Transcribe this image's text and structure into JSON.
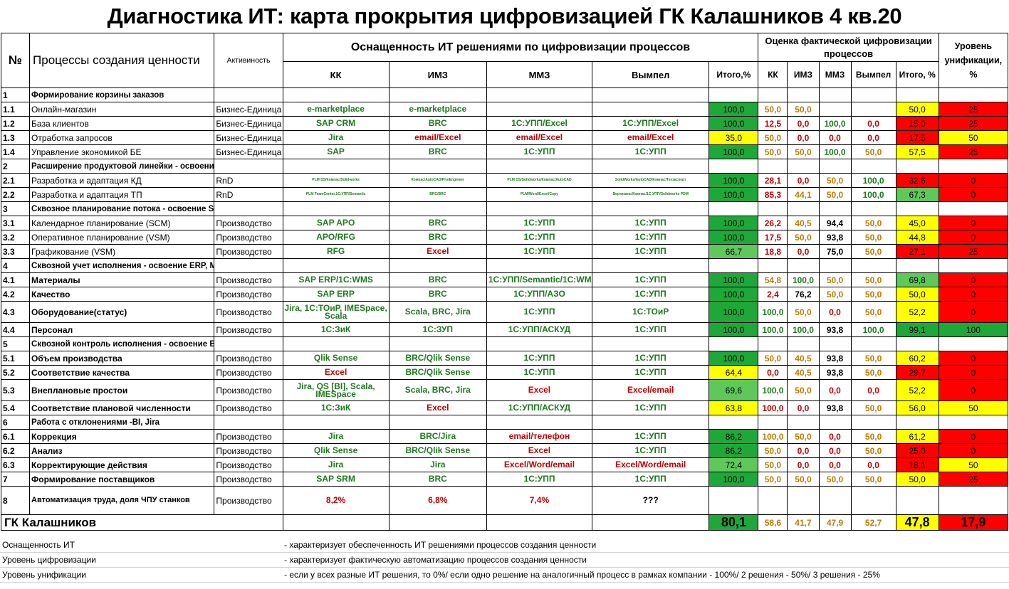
{
  "title": "Диагностика ИТ: карта прокрытия цифровизацией ГК Калашников 4 кв.20",
  "header": {
    "num": "№",
    "process": "Процессы создания ценности",
    "activity": "Активиность",
    "equipment_group": "Оснащенность ИТ решениями по цифровизации процессов",
    "digital_group": "Оценка фактической цифровизации процессов",
    "unification": "Уровень унификации, %",
    "cols": [
      "КК",
      "ИМЗ",
      "ММЗ",
      "Вымпел",
      "Итого,%"
    ],
    "dcols": [
      "КК",
      "ИМЗ",
      "ММЗ",
      "Вымпел",
      "Итого, %"
    ]
  },
  "rows": [
    {
      "t": "s",
      "num": "1",
      "name": "Формирование корзины заказов"
    },
    {
      "t": "r",
      "num": "1.1",
      "name": "Онлайн-магазин",
      "bold": false,
      "act": "Бизнес-Единица",
      "sys": [
        [
          "e-marketplace",
          "g"
        ],
        [
          "e-marketplace",
          "g"
        ],
        [
          "",
          ""
        ],
        [
          "",
          ""
        ]
      ],
      "tot": "100,0",
      "tc": "g",
      "v": [
        [
          "50,0",
          "o"
        ],
        [
          "50,0",
          "o"
        ],
        [
          "",
          ""
        ],
        [
          "",
          ""
        ]
      ],
      "dt": "50,0",
      "dc": "y",
      "u": "25",
      "uc": "r"
    },
    {
      "t": "r",
      "num": "1.2",
      "name": "База клиентов",
      "bold": false,
      "act": "Бизнес-Единица",
      "sys": [
        [
          "SAP CRM",
          "g"
        ],
        [
          "BRC",
          "g"
        ],
        [
          "1C:УПП/Excel",
          "g"
        ],
        [
          "1C:УПП/Excel",
          "g"
        ]
      ],
      "tot": "100,0",
      "tc": "g",
      "v": [
        [
          "12,5",
          "r"
        ],
        [
          "0,0",
          "r"
        ],
        [
          "100,0",
          "gr"
        ],
        [
          "0,0",
          "r"
        ]
      ],
      "dt": "15,0",
      "dc": "r",
      "u": "25",
      "uc": "r"
    },
    {
      "t": "r",
      "num": "1.3",
      "name": "Отработка запросов",
      "bold": false,
      "act": "Бизнес-Единица",
      "sys": [
        [
          "Jira",
          "g"
        ],
        [
          "email/Excel",
          "r"
        ],
        [
          "email/Excel",
          "r"
        ],
        [
          "email/Excel",
          "r"
        ]
      ],
      "tot": "35,0",
      "tc": "y",
      "v": [
        [
          "50,0",
          "o"
        ],
        [
          "0,0",
          "r"
        ],
        [
          "0,0",
          "r"
        ],
        [
          "0,0",
          "r"
        ]
      ],
      "dt": "17,5",
      "dc": "r",
      "u": "50",
      "uc": "y"
    },
    {
      "t": "r",
      "num": "1.4",
      "name": "Управление экономикой БЕ",
      "bold": false,
      "act": "Бизнес-Единица",
      "sys": [
        [
          "SAP",
          "g"
        ],
        [
          "BRC",
          "g"
        ],
        [
          "1C:УПП",
          "g"
        ],
        [
          "1C:УПП",
          "g"
        ]
      ],
      "tot": "100,0",
      "tc": "g",
      "v": [
        [
          "50,0",
          "o"
        ],
        [
          "50,0",
          "o"
        ],
        [
          "100,0",
          "gr"
        ],
        [
          "50,0",
          "o"
        ]
      ],
      "dt": "57,5",
      "dc": "y",
      "u": "25",
      "uc": "r"
    },
    {
      "t": "s",
      "num": "2",
      "name": "Расширение продуктовой линейки - освоение PLM"
    },
    {
      "t": "r",
      "num": "2.1",
      "name": "Разработка и адаптация КД",
      "bold": false,
      "act": "RnD",
      "sys": [
        [
          "PLM DS/Компас/Solidworks",
          "g",
          "small"
        ],
        [
          "Компас/AutoCAD/Pro/Engineer",
          "g",
          "small"
        ],
        [
          "PLM DS/Solidworks/Компас/AutoCAD",
          "g",
          "small"
        ],
        [
          "SolidWorks/AutoCAD/Компас/Техэксперт",
          "g",
          "small"
        ]
      ],
      "tot": "100,0",
      "tc": "g",
      "v": [
        [
          "28,1",
          "r"
        ],
        [
          "0,0",
          "r"
        ],
        [
          "50,0",
          "o"
        ],
        [
          "100,0",
          "gr"
        ]
      ],
      "dt": "32,6",
      "dc": "r",
      "u": "0",
      "uc": "r"
    },
    {
      "t": "r",
      "num": "2.2",
      "name": "Разработка и адаптация ТП",
      "bold": false,
      "act": "RnD",
      "sys": [
        [
          "PLM TeamCenter,1C:УПП/Semantic",
          "g",
          "small"
        ],
        [
          "BRC/BRC",
          "g",
          "small"
        ],
        [
          "PLM/Word/Excel/Copy",
          "g",
          "small"
        ],
        [
          "Вертикаль/Компас/1C:УПП/Solidworks PDM",
          "g",
          "small"
        ]
      ],
      "tot": "100,0",
      "tc": "g",
      "v": [
        [
          "85,3",
          "r"
        ],
        [
          "44,1",
          "o"
        ],
        [
          "50,0",
          "o"
        ],
        [
          "100,0",
          "gr"
        ]
      ],
      "dt": "67,3",
      "dc": "lg",
      "u": "0",
      "uc": "r"
    },
    {
      "t": "s",
      "num": "3",
      "name": "Сквозное планирование потока - освоение SCM/APS"
    },
    {
      "t": "r",
      "num": "3.1",
      "name": "Календарное планирование (SCM)",
      "bold": false,
      "act": "Производство",
      "sys": [
        [
          "SAP APO",
          "g"
        ],
        [
          "BRC",
          "g"
        ],
        [
          "1C:УПП",
          "g"
        ],
        [
          "1C:УПП",
          "g"
        ]
      ],
      "tot": "100,0",
      "tc": "g",
      "v": [
        [
          "26,2",
          "r"
        ],
        [
          "40,5",
          "o"
        ],
        [
          "94,4",
          "k"
        ],
        [
          "50,0",
          "o"
        ]
      ],
      "dt": "45,0",
      "dc": "y",
      "u": "0",
      "uc": "r"
    },
    {
      "t": "r",
      "num": "3.2",
      "name": "Оперативное планирование (VSM)",
      "bold": false,
      "act": "Производство",
      "sys": [
        [
          "APO/RFG",
          "g"
        ],
        [
          "BRC",
          "g"
        ],
        [
          "1C:УПП",
          "g"
        ],
        [
          "1C:УПП",
          "g"
        ]
      ],
      "tot": "100,0",
      "tc": "g",
      "v": [
        [
          "17,5",
          "r"
        ],
        [
          "50,0",
          "o"
        ],
        [
          "93,8",
          "k"
        ],
        [
          "50,0",
          "o"
        ]
      ],
      "dt": "44,8",
      "dc": "y",
      "u": "0",
      "uc": "r"
    },
    {
      "t": "r",
      "num": "3.3",
      "name": "Графикование (VSM)",
      "bold": false,
      "act": "Производство",
      "sys": [
        [
          "RFG",
          "g"
        ],
        [
          "Excel",
          "r"
        ],
        [
          "1C:УПП",
          "g"
        ],
        [
          "1C:УПП",
          "g"
        ]
      ],
      "tot": "66,7",
      "tc": "lg",
      "v": [
        [
          "18,8",
          "r"
        ],
        [
          "0,0",
          "r"
        ],
        [
          "75,0",
          "k"
        ],
        [
          "50,0",
          "o"
        ]
      ],
      "dt": "27,1",
      "dc": "r",
      "u": "25",
      "uc": "r"
    },
    {
      "t": "s",
      "num": "4",
      "name": "Сквозной учет исполнения  - освоение ERP, MES, SCADA"
    },
    {
      "t": "r",
      "num": "4.1",
      "name": "Материалы",
      "bold": true,
      "act": "Производство",
      "sys": [
        [
          "SAP ERP/1C:WMS",
          "g"
        ],
        [
          "BRC",
          "g"
        ],
        [
          "1C:УПП/Semantic/1C:WMS",
          "g"
        ],
        [
          "1C:УПП",
          "g"
        ]
      ],
      "tot": "100,0",
      "tc": "g",
      "v": [
        [
          "54,8",
          "o"
        ],
        [
          "100,0",
          "gr"
        ],
        [
          "50,0",
          "o"
        ],
        [
          "50,0",
          "o"
        ]
      ],
      "dt": "69,8",
      "dc": "lg",
      "u": "0",
      "uc": "r"
    },
    {
      "t": "r",
      "num": "4.2",
      "name": "Качество",
      "bold": true,
      "act": "Производство",
      "sys": [
        [
          "SAP ERP",
          "g"
        ],
        [
          "BRC",
          "g"
        ],
        [
          "1C:УПП/АЗО",
          "g"
        ],
        [
          "1C:УПП",
          "g"
        ]
      ],
      "tot": "100,0",
      "tc": "g",
      "v": [
        [
          "2,4",
          "r"
        ],
        [
          "76,2",
          "k"
        ],
        [
          "50,0",
          "o"
        ],
        [
          "50,0",
          "o"
        ]
      ],
      "dt": "50,0",
      "dc": "y",
      "u": "0",
      "uc": "r"
    },
    {
      "t": "r",
      "num": "4.3",
      "name": "Оборудование(статус)",
      "bold": true,
      "tall": true,
      "act": "Производство",
      "sys": [
        [
          "Jira, 1C:ТОиР, IMESpace, Scala",
          "g"
        ],
        [
          "Scala, BRC, Jira",
          "g"
        ],
        [
          "1C:УПП",
          "g"
        ],
        [
          "1C:ТОиР",
          "g"
        ]
      ],
      "tot": "100,0",
      "tc": "g",
      "v": [
        [
          "100,0",
          "gr"
        ],
        [
          "50,0",
          "o"
        ],
        [
          "0,0",
          "r"
        ],
        [
          "50,0",
          "o"
        ]
      ],
      "dt": "52,2",
      "dc": "y",
      "u": "0",
      "uc": "r"
    },
    {
      "t": "r",
      "num": "4.4",
      "name": "Персонал",
      "bold": true,
      "act": "Производство",
      "sys": [
        [
          "1C:ЗиК",
          "g"
        ],
        [
          "1C:ЗУП",
          "g"
        ],
        [
          "1C:УПП/АСКУД",
          "g"
        ],
        [
          "1C:УПП",
          "g"
        ]
      ],
      "tot": "100,0",
      "tc": "g",
      "v": [
        [
          "100,0",
          "gr"
        ],
        [
          "100,0",
          "gr"
        ],
        [
          "93,8",
          "k"
        ],
        [
          "100,0",
          "gr"
        ]
      ],
      "dt": "99,1",
      "dc": "g",
      "u": "100",
      "uc": "g"
    },
    {
      "t": "s",
      "num": "5",
      "name": "Сквозной контроль исполнения - освоение BI/QS"
    },
    {
      "t": "r",
      "num": "5.1",
      "name": "Объем производства",
      "bold": true,
      "act": "Производство",
      "sys": [
        [
          "Qlik Sense",
          "g"
        ],
        [
          "BRC/Qlik Sense",
          "g"
        ],
        [
          "1C:УПП",
          "g"
        ],
        [
          "1C:УПП",
          "g"
        ]
      ],
      "tot": "100,0",
      "tc": "g",
      "v": [
        [
          "50,0",
          "o"
        ],
        [
          "40,5",
          "o"
        ],
        [
          "93,8",
          "k"
        ],
        [
          "50,0",
          "o"
        ]
      ],
      "dt": "60,2",
      "dc": "y",
      "u": "0",
      "uc": "r"
    },
    {
      "t": "r",
      "num": "5.2",
      "name": "Соответствие качества",
      "bold": true,
      "act": "Производство",
      "sys": [
        [
          "Excel",
          "r"
        ],
        [
          "BRC/Qlik Sense",
          "g"
        ],
        [
          "1C:УПП",
          "g"
        ],
        [
          "1C:УПП",
          "g"
        ]
      ],
      "tot": "64,4",
      "tc": "y",
      "v": [
        [
          "0,0",
          "r"
        ],
        [
          "40,5",
          "o"
        ],
        [
          "93,8",
          "k"
        ],
        [
          "50,0",
          "o"
        ]
      ],
      "dt": "29,7",
      "dc": "r",
      "u": "0",
      "uc": "r"
    },
    {
      "t": "r",
      "num": "5.3",
      "name": "Внеплановые простои",
      "bold": true,
      "tall": true,
      "act": "Производство",
      "sys": [
        [
          "Jira, QS [BI], Scala, IMESpace",
          "g"
        ],
        [
          "Scala, BRC, Jira",
          "g"
        ],
        [
          "Excel",
          "r"
        ],
        [
          "Excel/email",
          "r"
        ]
      ],
      "tot": "69,6",
      "tc": "lg",
      "v": [
        [
          "100,0",
          "gr"
        ],
        [
          "50,0",
          "o"
        ],
        [
          "0,0",
          "r"
        ],
        [
          "0,0",
          "r"
        ]
      ],
      "dt": "52,2",
      "dc": "y",
      "u": "0",
      "uc": "r"
    },
    {
      "t": "r",
      "num": "5.4",
      "name": "Соответствие плановой численности",
      "bold": true,
      "act": "Производство",
      "sys": [
        [
          "1C:ЗиК",
          "g"
        ],
        [
          "Excel",
          "r"
        ],
        [
          "1C:УПП/АСКУД",
          "g"
        ],
        [
          "1C:УПП",
          "g"
        ]
      ],
      "tot": "63,8",
      "tc": "y",
      "v": [
        [
          "100,0",
          "r"
        ],
        [
          "0,0",
          "r"
        ],
        [
          "93,8",
          "k"
        ],
        [
          "50,0",
          "o"
        ]
      ],
      "dt": "56,0",
      "dc": "y",
      "u": "50",
      "uc": "y"
    },
    {
      "t": "s",
      "num": "6",
      "name": "Работа с отклонениями -BI, Jira"
    },
    {
      "t": "r",
      "num": "6.1",
      "name": "Коррекция",
      "bold": true,
      "act": "Производство",
      "sys": [
        [
          "Jira",
          "g"
        ],
        [
          "BRC/Jira",
          "g"
        ],
        [
          "email/телефон",
          "r"
        ],
        [
          "1C:УПП",
          "g"
        ]
      ],
      "tot": "86,2",
      "tc": "g",
      "v": [
        [
          "100,0",
          "o"
        ],
        [
          "50,0",
          "o"
        ],
        [
          "0,0",
          "r"
        ],
        [
          "50,0",
          "o"
        ]
      ],
      "dt": "61,2",
      "dc": "y",
      "u": "0",
      "uc": "r"
    },
    {
      "t": "r",
      "num": "6.2",
      "name": "Анализ",
      "bold": true,
      "act": "Производство",
      "sys": [
        [
          "Qlik Sense",
          "g"
        ],
        [
          "BRC/Qlik Sense",
          "g"
        ],
        [
          "Excel",
          "r"
        ],
        [
          "1C:УПП",
          "g"
        ]
      ],
      "tot": "86,2",
      "tc": "g",
      "v": [
        [
          "50,0",
          "o"
        ],
        [
          "0,0",
          "r"
        ],
        [
          "0,0",
          "r"
        ],
        [
          "50,0",
          "o"
        ]
      ],
      "dt": "25,0",
      "dc": "r",
      "u": "0",
      "uc": "r"
    },
    {
      "t": "r",
      "num": "6.3",
      "name": "Корректирующие действия",
      "bold": true,
      "act": "Производство",
      "sys": [
        [
          "Jira",
          "g"
        ],
        [
          "Jira",
          "g"
        ],
        [
          "Excel/Word/email",
          "r"
        ],
        [
          "Excel/Word/email",
          "r"
        ]
      ],
      "tot": "72,4",
      "tc": "lg",
      "v": [
        [
          "50,0",
          "o"
        ],
        [
          "0,0",
          "r"
        ],
        [
          "0,0",
          "r"
        ],
        [
          "0,0",
          "r"
        ]
      ],
      "dt": "18,1",
      "dc": "r",
      "u": "50",
      "uc": "y"
    },
    {
      "t": "r",
      "num": "7",
      "name": "Формирование поставщиков",
      "bold": true,
      "act": "Производство",
      "sys": [
        [
          "SAP SRM",
          "g"
        ],
        [
          "BRC",
          "g"
        ],
        [
          "1C:УПП",
          "g"
        ],
        [
          "1C:УПП",
          "g"
        ]
      ],
      "tot": "100,0",
      "tc": "g",
      "v": [
        [
          "50,0",
          "o"
        ],
        [
          "50,0",
          "o"
        ],
        [
          "50,0",
          "o"
        ],
        [
          "50,0",
          "o"
        ]
      ],
      "dt": "50,0",
      "dc": "y",
      "u": "25",
      "uc": "r"
    },
    {
      "t": "r",
      "num": "8",
      "name": "Автоматизация труда,  доля ЧПУ станков",
      "bold": true,
      "tall2": true,
      "act": "Производство",
      "sys": [
        [
          "8,2%",
          "r"
        ],
        [
          "6,8%",
          "r"
        ],
        [
          "7,4%",
          "r"
        ],
        [
          "???",
          "k"
        ]
      ],
      "tot": "",
      "tc": "",
      "v": [
        [
          "",
          ""
        ],
        [
          "",
          ""
        ],
        [
          "",
          ""
        ],
        [
          "",
          ""
        ]
      ],
      "dt": "",
      "dc": "",
      "u": "",
      "uc": ""
    }
  ],
  "summary": {
    "name": "ГК Калашников",
    "tot": "80,1",
    "v": [
      "58,6",
      "41,7",
      "47,9",
      "52,7"
    ],
    "dt": "47,8",
    "u": "17,9"
  },
  "footer": [
    {
      "k": "Оснащенность ИТ",
      "d": "- характеризует обеспеченность ИТ решениями процессов создания ценности"
    },
    {
      "k": "Уровень цифровизации",
      "d": "- характеризует фактическую автоматизацию процессов создания ценности"
    },
    {
      "k": "Уровень унификации",
      "d": "- если у всех разные ИТ решения, то 0%/ если одно решение на аналогичный процесс в рамках компании - 100%/ 2 решения - 50%/ 3 решения - 25%"
    }
  ]
}
